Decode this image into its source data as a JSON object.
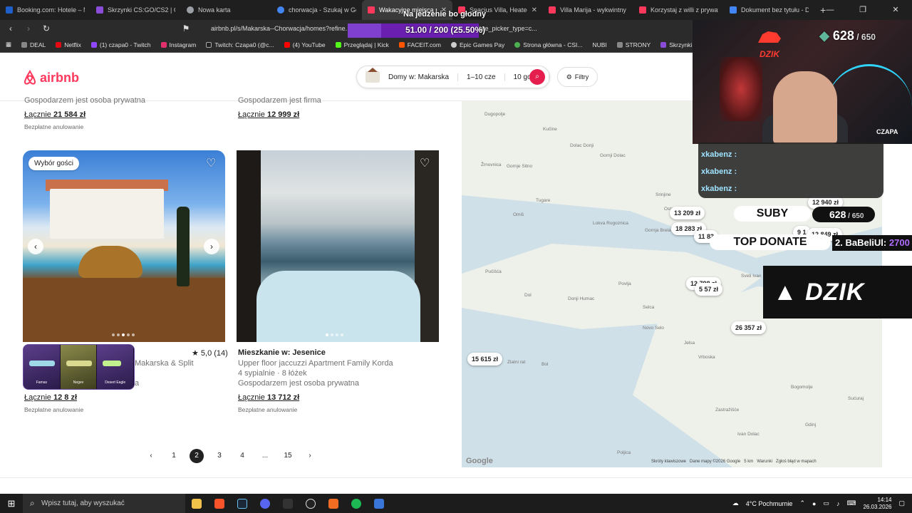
{
  "browser": {
    "tabs": [
      {
        "label": "Booking.com: Hotele – Ma",
        "color": "#1f5fc9"
      },
      {
        "label": "Skrzynki CS:GO/CS2 | G4S",
        "color": "#8b4cd8"
      },
      {
        "label": "Nowa karta",
        "color": "#9aa0a6"
      },
      {
        "label": "chorwacja - Szukaj w Goo",
        "color": "#4285f4"
      },
      {
        "label": "Wakacyjne miejsca po",
        "color": "#ff385c"
      },
      {
        "label": "Spacius Villa, Heated",
        "color": "#ff385c"
      },
      {
        "label": "Villa Marija - wykwintny d",
        "color": "#ff385c"
      },
      {
        "label": "Korzystaj z willi z prywatn",
        "color": "#ff385c"
      },
      {
        "label": "Dokument bez tytułu - Do",
        "color": "#4285f4"
      }
    ],
    "url": "airbnb.pl/s/Makarska--Chorwacja/homes?refine...9%25...2026-06-01&checkout=2026-06-10&date_picker_type=c...",
    "bookmarks": [
      {
        "label": "DEAL",
        "color": "#888888"
      },
      {
        "label": "Netflix",
        "color": "#e50914"
      },
      {
        "label": "(1) czapa0 - Twitch",
        "color": "#9146ff"
      },
      {
        "label": "Instagram",
        "color": "#e1306c"
      },
      {
        "label": "Twitch: Czapa0 (@c...",
        "color": "#222222"
      },
      {
        "label": "(4) YouTube",
        "color": "#ff0000"
      },
      {
        "label": "Przeglądaj | Kick",
        "color": "#53fc18"
      },
      {
        "label": "FACEIT.com",
        "color": "#ff5500"
      },
      {
        "label": "Epic Games Pay",
        "color": "#cccccc"
      },
      {
        "label": "Strona główna - CSI...",
        "color": "#4caf50"
      },
      {
        "label": "NUBI",
        "color": "#2b2b2b"
      },
      {
        "label": "STRONY",
        "color": "#888888"
      },
      {
        "label": "Skrzynki CS:GO/CS...",
        "color": "#8b4cd8"
      }
    ]
  },
  "airbnb": {
    "logo": "airbnb",
    "search": {
      "location": "Domy w: Makarska",
      "dates": "1–10 cze",
      "guests": "10 gości"
    },
    "filters_label": "Filtry",
    "prev_row": [
      {
        "host": "Gospodarzem jest osoba prywatna",
        "total_label": "Łącznie",
        "total": "21 584 zł",
        "cancel": "Bezpłatne anulowanie"
      },
      {
        "host": "Gospodarzem jest firma",
        "total_label": "Łącznie",
        "total": "12 999 zł"
      }
    ],
    "listings": [
      {
        "badge": "Wybór gości",
        "rating": "★ 5,0 (14)",
        "title_visible": "Makarska & Split",
        "subtitle_visible": "a",
        "total_label": "Łącznie",
        "total": "12 8",
        "total_suffix": "zł",
        "cancel": "Bezpłatne anulowanie"
      },
      {
        "title": "Mieszkanie w: Jesenice",
        "name": "Upper floor jaccuzzi Apartment Family Korda",
        "rooms": "4 sypialnie · 8 łóżek",
        "host": "Gospodarzem jest osoba prywatna",
        "total_label": "Łącznie",
        "total": "13 712 zł",
        "cancel": "Bezpłatne anulowanie"
      }
    ],
    "pagination": {
      "prev": "‹",
      "pages": [
        "1",
        "2",
        "3",
        "4",
        "...",
        "15"
      ],
      "active": "2",
      "next": "›"
    }
  },
  "map": {
    "places": [
      "Dugopolje",
      "Kučine",
      "Dolac Donji",
      "Gornje Sitno",
      "Žrnovnica",
      "Gornji Dolac",
      "Tugare",
      "Lokva Rogoznica",
      "Omiš",
      "Pučišća",
      "Dol",
      "Povlja",
      "Donji Humac",
      "Selca",
      "Novo Selo",
      "Bol",
      "Zlatni rat",
      "Sveti Ivan",
      "Jelsa",
      "Vrboska",
      "Zastražišće",
      "Poljica",
      "Ivan Dolac",
      "Gdinj",
      "Bogomolje",
      "Sućuraj",
      "Gornja Brela",
      "Srinjine",
      "Ostrvica"
    ],
    "prices": [
      "12 940 zł",
      "13 209 zł",
      "18 283 zł",
      "11 83",
      "9 1",
      "12 849 zł",
      "12 798 zł",
      "5 57 zł",
      "26 357 zł",
      "15 615 zł"
    ],
    "footer": [
      "Skróty klawiszowe",
      "Dane mapy ©2026 Google",
      "5 km",
      "Warunki",
      "Zgłoś błąd w mapach"
    ],
    "google": "Google"
  },
  "overlay": {
    "goal_text": "Na jedzenie bo głodny",
    "goal_progress": "51.00 / 200 (25.50%)",
    "goal_fraction": 0.255,
    "cam_name": "CZAPA",
    "subs_now": "628",
    "subs_goal": "650",
    "chat": [
      "xkabenz :",
      "xkabenz :",
      "xkabenz :"
    ],
    "suby_label": "SUBY",
    "topdonate_label": "TOP DONATE",
    "topdonate_name": "2. BaBeliUl:",
    "topdonate_amount": "2700",
    "brand": "DZIK"
  },
  "skins": [
    {
      "name": "Famas"
    },
    {
      "name": "Negev"
    },
    {
      "name": "Desert Eagle"
    }
  ],
  "taskbar": {
    "search_placeholder": "Wpisz tutaj, aby wyszukać",
    "weather": "4°C  Pochmurnie",
    "time": "14:14",
    "date": "26.03.2026",
    "apps": [
      {
        "name": "file-explorer",
        "color": "#f0c24a"
      },
      {
        "name": "brave",
        "color": "#fb542b"
      },
      {
        "name": "steam",
        "color": "#1b2838"
      },
      {
        "name": "discord",
        "color": "#5865f2"
      },
      {
        "name": "epic",
        "color": "#333333"
      },
      {
        "name": "faceit",
        "color": "#222222"
      },
      {
        "name": "app-orange",
        "color": "#f26d21"
      },
      {
        "name": "spotify",
        "color": "#1db954"
      },
      {
        "name": "calculator",
        "color": "#3a76d8"
      }
    ]
  }
}
